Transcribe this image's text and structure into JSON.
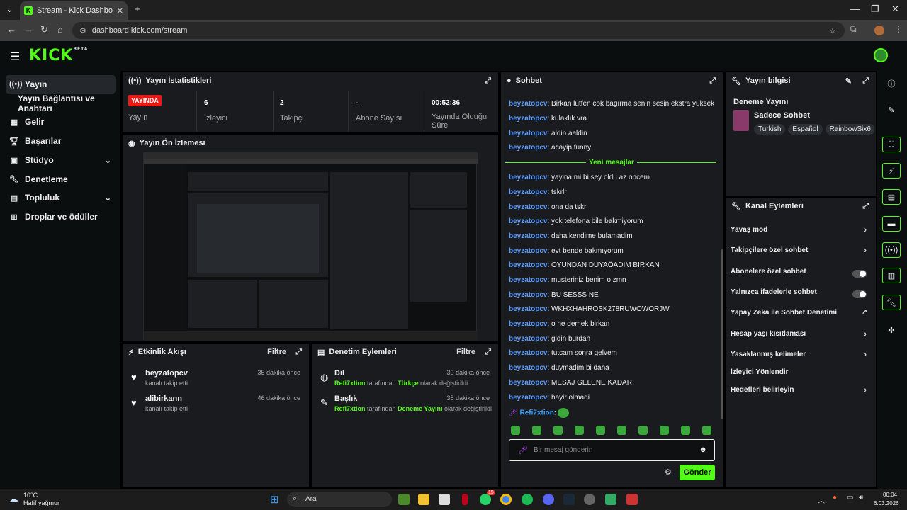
{
  "browser": {
    "tab_title": "Stream - Kick Dashboard",
    "url": "dashboard.kick.com/stream"
  },
  "header": {
    "logo": "KICK",
    "logo_badge": "BETA"
  },
  "sidebar": {
    "items": [
      {
        "label": "Yayın",
        "icon": "stream-icon"
      },
      {
        "label": "Yayın Bağlantısı ve Anahtarı",
        "icon": ""
      },
      {
        "label": "Gelir",
        "icon": "revenue-icon"
      },
      {
        "label": "Başarılar",
        "icon": "trophy-icon"
      },
      {
        "label": "Stüdyo",
        "icon": "studio-icon"
      },
      {
        "label": "Denetleme",
        "icon": "wrench-icon"
      },
      {
        "label": "Topluluk",
        "icon": "community-icon"
      },
      {
        "label": "Droplar ve ödüller",
        "icon": "gift-icon"
      }
    ]
  },
  "stats": {
    "title": "Yayın İstatistikleri",
    "live_badge": "YAYINDA",
    "live_label": "Yayın",
    "viewers_value": "6",
    "viewers_label": "İzleyici",
    "followers_value": "2",
    "followers_label": "Takipçi",
    "subs_value": "-",
    "subs_label": "Abone Sayısı",
    "uptime_value": "00:52:36",
    "uptime_label": "Yayında Olduğu Süre"
  },
  "preview": {
    "title": "Yayın Ön İzlemesi"
  },
  "activity": {
    "title": "Etkinlik Akışı",
    "filter": "Filtre",
    "items": [
      {
        "name": "beyzatopcv",
        "sub": "kanalı takip etti",
        "time": "35 dakika önce"
      },
      {
        "name": "alibirkann",
        "sub": "kanalı takip etti",
        "time": "46 dakika önce"
      }
    ]
  },
  "moderation": {
    "title": "Denetim Eylemleri",
    "filter": "Filtre",
    "items": [
      {
        "name": "Dil",
        "actor": "Refi7xtion",
        "mid": "tarafından",
        "value": "Türkçe",
        "tail": "olarak değiştirildi",
        "time": "30 dakika önce"
      },
      {
        "name": "Başlık",
        "actor": "Refi7xtion",
        "mid": "tarafından",
        "value": "Deneme Yayını",
        "tail": "olarak değiştirildi",
        "time": "38 dakika önce"
      }
    ]
  },
  "chat": {
    "title": "Sohbet",
    "new_messages": "Yeni mesajlar",
    "messages": [
      {
        "user": "beyzatopcv",
        "text": "Birkan lutfen cok bagırma senin sesin ekstra yuksek"
      },
      {
        "user": "beyzatopcv",
        "text": "kulaklık vra"
      },
      {
        "user": "beyzatopcv",
        "text": "aldin aaldin"
      },
      {
        "user": "beyzatopcv",
        "text": "acayip funny"
      },
      {
        "user": "beyzatopcv",
        "text": "yayina mi bi sey oldu az oncem"
      },
      {
        "user": "beyzatopcv",
        "text": "tskrlr"
      },
      {
        "user": "beyzatopcv",
        "text": "ona da tskr"
      },
      {
        "user": "beyzatopcv",
        "text": "yok telefona bile bakmiyorum"
      },
      {
        "user": "beyzatopcv",
        "text": "daha kendime bulamadim"
      },
      {
        "user": "beyzatopcv",
        "text": "evt bende bakmıyorum"
      },
      {
        "user": "beyzatopcv",
        "text": "OYUNDAN DUYAÖADIM BİRKAN"
      },
      {
        "user": "beyzatopcv",
        "text": "musteriniz benim o zmn"
      },
      {
        "user": "beyzatopcv",
        "text": "BU SESSS NE"
      },
      {
        "user": "beyzatopcv",
        "text": "WKHXHAHROSK278RUWOWORJW"
      },
      {
        "user": "beyzatopcv",
        "text": "o ne demek birkan"
      },
      {
        "user": "beyzatopcv",
        "text": "gidin burdan"
      },
      {
        "user": "beyzatopcv",
        "text": "tutcam sonra gelvem"
      },
      {
        "user": "beyzatopcv",
        "text": "duymadim bi daha"
      },
      {
        "user": "beyzatopcv",
        "text": "MESAJ GELENE KADAR"
      },
      {
        "user": "beyzatopcv",
        "text": "hayir olmadi"
      }
    ],
    "last_user": "Refi7xtion",
    "input_placeholder": "Bir mesaj gönderin",
    "send_label": "Gönder"
  },
  "stream_info": {
    "title": "Yayın bilgisi",
    "stream_title": "Deneme Yayını",
    "category": "Sadece Sohbet",
    "tags": [
      "Turkish",
      "Español",
      "RainbowSix6"
    ]
  },
  "channel_actions": {
    "title": "Kanal Eylemleri",
    "items": [
      {
        "label": "Yavaş mod",
        "control": "chevron"
      },
      {
        "label": "Takipçilere özel sohbet",
        "control": "chevron"
      },
      {
        "label": "Abonelere özel sohbet",
        "control": "toggle"
      },
      {
        "label": "Yalnızca ifadelerle sohbet",
        "control": "toggle"
      },
      {
        "label": "Yapay Zeka ile Sohbet Denetimi",
        "control": "external"
      },
      {
        "label": "Hesap yaşı kısıtlaması",
        "control": "chevron"
      },
      {
        "label": "Yasaklanmış kelimeler",
        "control": "chevron"
      },
      {
        "label": "İzleyici Yönlendir",
        "control": "none"
      },
      {
        "label": "Hedefleri belirleyin",
        "control": "chevron"
      }
    ]
  },
  "taskbar": {
    "weather_temp": "10°C",
    "weather_desc": "Hafif yağmur",
    "search": "Ara",
    "badge_count": "15",
    "time": "00:04",
    "date": "6.03.2026"
  }
}
